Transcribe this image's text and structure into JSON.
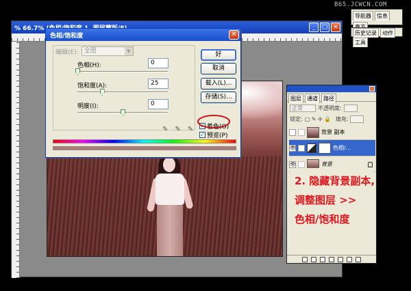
{
  "watermark": "B65.JCWCN.COM",
  "document": {
    "title": "% 66.7% (色相/饱和度 1, 图层蒙版/8)",
    "window_buttons": [
      "_",
      "□",
      "✕"
    ]
  },
  "dialog": {
    "title": "色相/饱和度",
    "edit_label": "编辑(E):",
    "edit_value": "全图",
    "hue_label": "色相(H):",
    "hue_value": "0",
    "saturation_label": "饱和度(A):",
    "saturation_value": "25",
    "lightness_label": "明度(I):",
    "lightness_value": "0",
    "buttons": {
      "ok": "好",
      "cancel": "取消",
      "load": "载入(L)...",
      "save": "存储(S)..."
    },
    "colorize_label": "着色(O)",
    "colorize_checked": true,
    "preview_label": "预览(P)",
    "preview_checked": true,
    "slider_positions": {
      "hue": 0.0,
      "saturation": 0.27,
      "lightness": 0.5
    }
  },
  "panels": {
    "navigator_tabs": [
      "导航器",
      "信息",
      "直方"
    ],
    "history_tabs": [
      "历史记录",
      "动作",
      "工具"
    ],
    "layers": {
      "tabs": [
        "图层",
        "通道",
        "路径"
      ],
      "blend_mode": "正常",
      "opacity_label": "不透明度:",
      "lock_label": "锁定:",
      "fill_label": "填充:",
      "items": [
        {
          "name": "背景 副本",
          "visible": false,
          "selected": false,
          "has_mask": false
        },
        {
          "name": "色相/...",
          "visible": true,
          "selected": true,
          "has_mask": true
        },
        {
          "name": "背景",
          "visible": true,
          "selected": false,
          "has_mask": false
        }
      ]
    }
  },
  "annotation": {
    "line1": "2. 隐藏背景副本,",
    "line2": "调整图层 >>",
    "line3": "色相/饱和度"
  },
  "colors": {
    "accent": "#1b4fc9",
    "highlight_ring": "#c0161b",
    "annotation_text": "#e0161d",
    "tint": "#b07a76"
  }
}
